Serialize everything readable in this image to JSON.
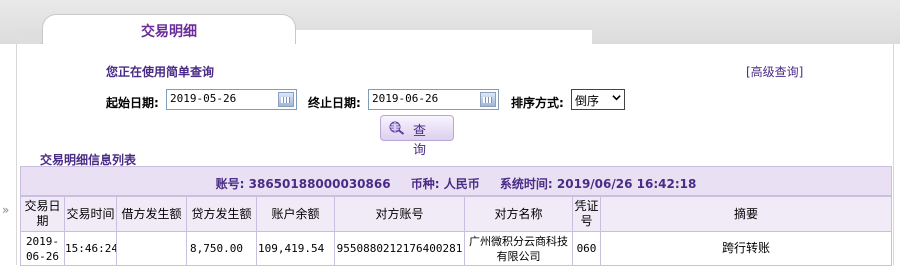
{
  "tab": {
    "title": "交易明细"
  },
  "query": {
    "mode_hint": "您正在使用简单查询",
    "advanced_link": "[高级查询]",
    "start_label": "起始日期:",
    "start_value": "2019-05-26",
    "end_label": "终止日期:",
    "end_value": "2019-06-26",
    "sort_label": "排序方式:",
    "sort_value": "倒序",
    "query_button": "查 询"
  },
  "list": {
    "title": "交易明细信息列表",
    "account": "账号: 38650188000030866",
    "currency": "币种: 人民币",
    "system_time": "系统时间: 2019/06/26 16:42:18"
  },
  "table": {
    "headers": [
      "交易日期",
      "交易时间",
      "借方发生额",
      "贷方发生额",
      "账户余额",
      "对方账号",
      "对方名称",
      "凭证号",
      "摘要"
    ],
    "rows": [
      {
        "date": "2019-06-26",
        "time": "15:46:24",
        "debit": "",
        "credit": "8,750.00",
        "balance": "109,419.54",
        "counter_account": "9550880212176400281",
        "counter_name": "广州微积分云商科技有限公司",
        "voucher": "060",
        "summary": "跨行转账"
      }
    ]
  },
  "colors": {
    "accent": "#4a2c86",
    "bar_bg": "#e9e1f3",
    "border": "#cbbfe0"
  },
  "icons": {
    "calendar": "calendar-icon",
    "query": "magnifier-globe-icon",
    "dropdown": "chevron-down-icon"
  }
}
